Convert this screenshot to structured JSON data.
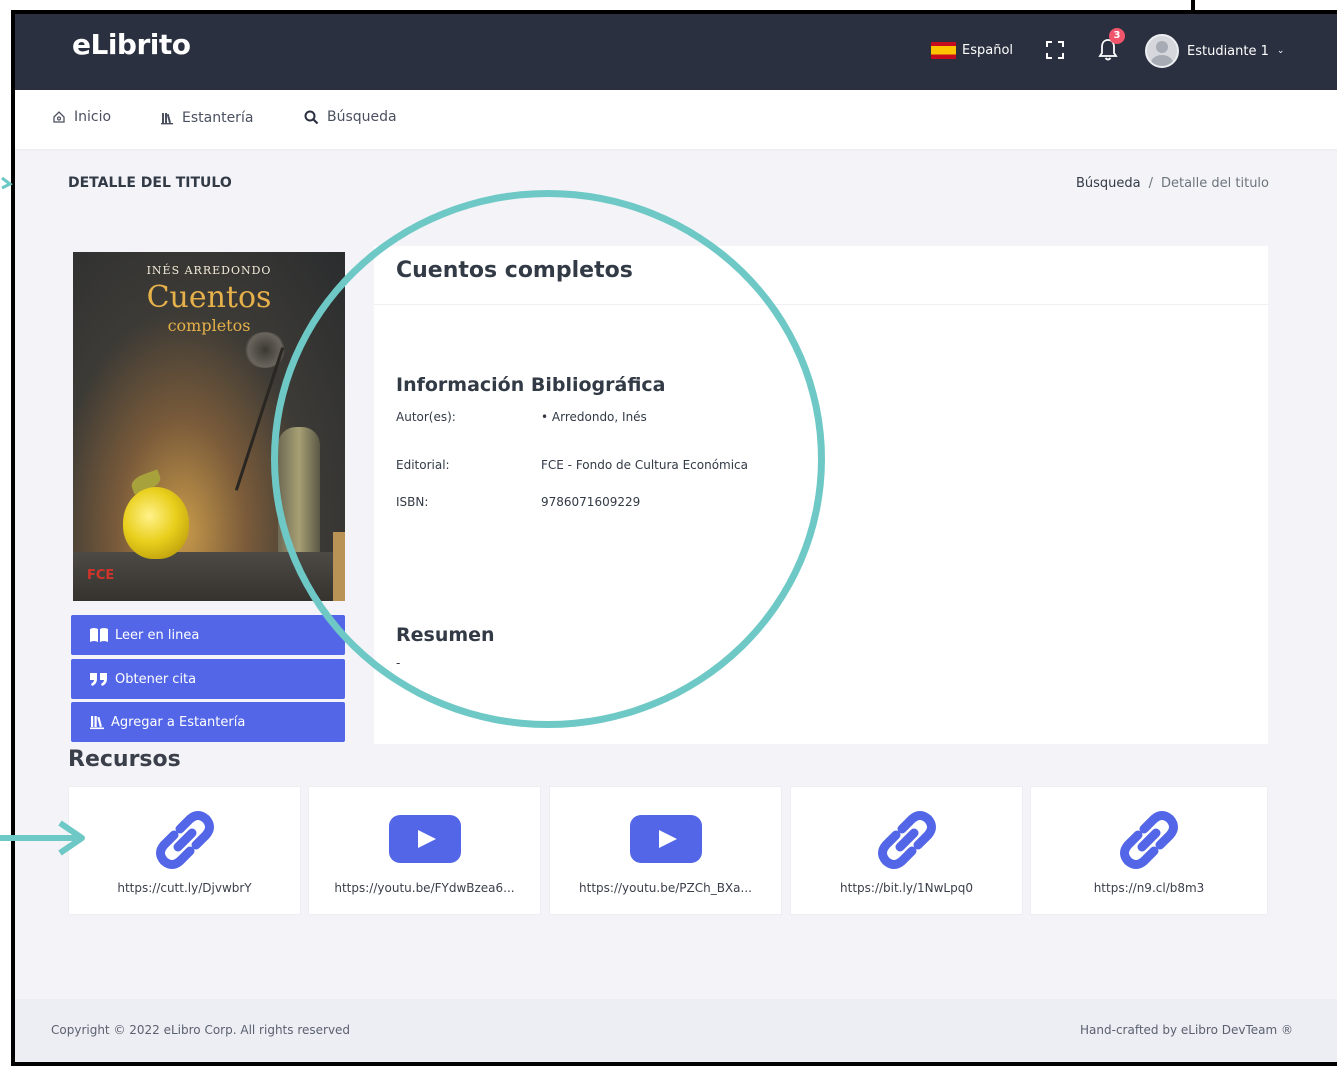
{
  "header": {
    "logo": "eLibrito",
    "language": "Español",
    "notifications_count": "3",
    "user": "Estudiante 1"
  },
  "nav": {
    "home": "Inicio",
    "shelf": "Estantería",
    "search": "Búsqueda"
  },
  "page": {
    "title": "DETALLE DEL TITULO",
    "breadcrumb": [
      "Búsqueda",
      "/",
      "Detalle del titulo"
    ]
  },
  "cover": {
    "author": "INÉS ARREDONDO",
    "title": "Cuentos",
    "subtitle": "completos",
    "publisher_mark": "FCE"
  },
  "actions": {
    "read": "Leer en linea",
    "cite": "Obtener cita",
    "add_shelf": "Agregar a Estantería"
  },
  "book": {
    "title": "Cuentos completos",
    "biblio_heading": "Información Bibliográfica",
    "author_label": "Autor(es):",
    "author_value": "• Arredondo, Inés",
    "publisher_label": "Editorial:",
    "publisher_value": "FCE - Fondo de Cultura Económica",
    "isbn_label": "ISBN:",
    "isbn_value": "9786071609229",
    "summary_heading": "Resumen",
    "summary_value": "-"
  },
  "resources": {
    "heading": "Recursos",
    "items": [
      {
        "type": "link-icon",
        "url": "https://cutt.ly/DjvwbrY"
      },
      {
        "type": "youtube-icon",
        "url": "https://youtu.be/FYdwBzea6..."
      },
      {
        "type": "youtube-icon",
        "url": "https://youtu.be/PZCh_BXa..."
      },
      {
        "type": "link-icon",
        "url": "https://bit.ly/1NwLpq0"
      },
      {
        "type": "link-icon",
        "url": "https://n9.cl/b8m3"
      }
    ]
  },
  "footer": {
    "copyright": "Copyright © 2022 eLibro Corp. All rights reserved",
    "credit": "Hand-crafted by eLibro DevTeam ®"
  },
  "colors": {
    "topbar": "#2b3040",
    "accent": "#5266e7",
    "annotation": "#6ec9c6"
  }
}
